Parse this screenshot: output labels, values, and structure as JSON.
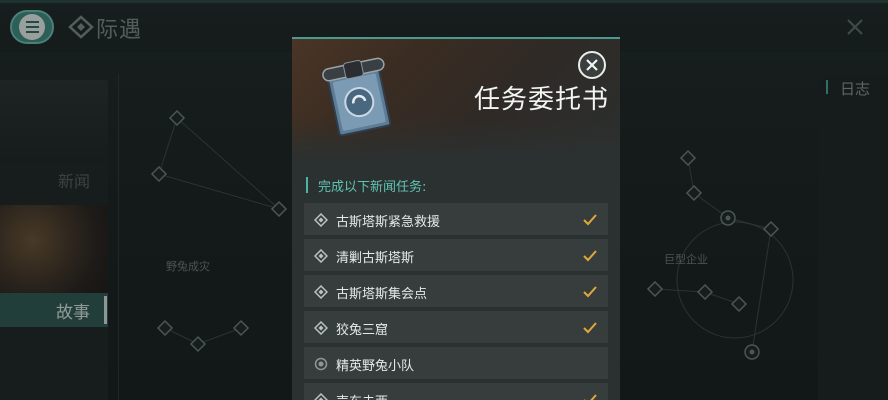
{
  "header": {
    "title": "际遇",
    "menu_icon": "hamburger-menu-icon",
    "close_icon": "close-icon"
  },
  "sidebar": {
    "items": [
      {
        "label": "新闻",
        "active": false
      },
      {
        "label": "故事",
        "active": true
      }
    ]
  },
  "map": {
    "labels": [
      "野兔成灾",
      "巨型企业"
    ]
  },
  "journal": {
    "label": "日志"
  },
  "modal": {
    "title": "任务委托书",
    "subtitle": "完成以下新闻任务:",
    "close_icon": "close-circle-icon",
    "tasks": [
      {
        "label": "古斯塔斯紧急救援",
        "completed": true
      },
      {
        "label": "清剿古斯塔斯",
        "completed": true
      },
      {
        "label": "古斯塔斯集会点",
        "completed": true
      },
      {
        "label": "狡兔三窟",
        "completed": true
      },
      {
        "label": "精英野兔小队",
        "completed": false
      },
      {
        "label": "声东击西",
        "completed": true
      }
    ]
  },
  "colors": {
    "accent": "#4db3a2",
    "check": "#e0a83a",
    "menu_button": "#3f8c80"
  }
}
